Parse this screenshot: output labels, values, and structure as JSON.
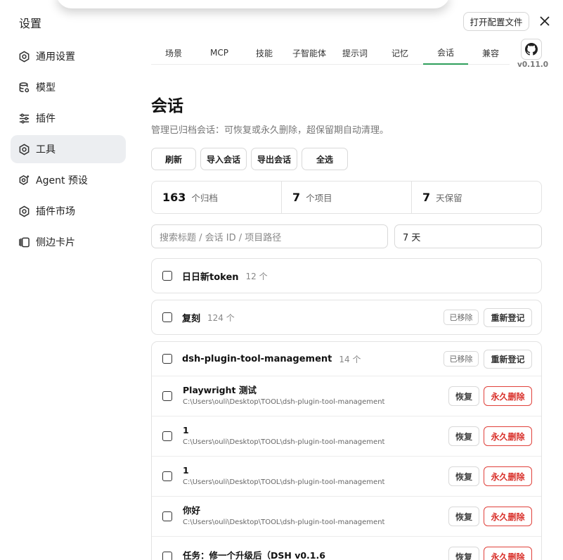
{
  "window": {
    "title": "设置",
    "open_config_label": "打开配置文件"
  },
  "sidebar": {
    "items": [
      {
        "label": "通用设置",
        "icon": "gear-icon"
      },
      {
        "label": "模型",
        "icon": "database-icon"
      },
      {
        "label": "插件",
        "icon": "sliders-icon"
      },
      {
        "label": "工具",
        "icon": "gear-icon",
        "active": true
      },
      {
        "label": "Agent 预设",
        "icon": "gear-sparkle-icon"
      },
      {
        "label": "插件市场",
        "icon": "gear-icon"
      },
      {
        "label": "侧边卡片",
        "icon": "side-card-icon"
      }
    ]
  },
  "tabs": {
    "items": [
      "场景",
      "MCP",
      "技能",
      "子智能体",
      "提示词",
      "记忆",
      "会话",
      "兼容"
    ],
    "active": "会话"
  },
  "version": "v0.11.0",
  "page": {
    "title": "会话",
    "description": "管理已归档会话：可恢复或永久删除，超保留期自动清理。"
  },
  "actions": {
    "refresh": "刷新",
    "import": "导入会话",
    "export": "导出会话",
    "select_all": "全选"
  },
  "stats": [
    {
      "value": "163",
      "unit": "个归档"
    },
    {
      "value": "7",
      "unit": "个项目"
    },
    {
      "value": "7",
      "unit": "天保留"
    }
  ],
  "search": {
    "placeholder": "搜索标题 / 会话 ID / 项目路径"
  },
  "retention_select": {
    "value": "7 天"
  },
  "labels": {
    "removed": "已移除",
    "reregister": "重新登记",
    "restore": "恢复",
    "delete": "永久删除"
  },
  "groups": [
    {
      "name": "日日新token",
      "count": "12 个"
    },
    {
      "name": "复刻",
      "count": "124 个"
    },
    {
      "name": "dsh-plugin-tool-management",
      "count": "14 个",
      "sessions": [
        {
          "title": "Playwright 测试",
          "path": "C:\\Users\\ouli\\Desktop\\TOOL\\dsh-plugin-tool-management"
        },
        {
          "title": "1",
          "path": "C:\\Users\\ouli\\Desktop\\TOOL\\dsh-plugin-tool-management"
        },
        {
          "title": "1",
          "path": "C:\\Users\\ouli\\Desktop\\TOOL\\dsh-plugin-tool-management"
        },
        {
          "title": "你好",
          "path": "C:\\Users\\ouli\\Desktop\\TOOL\\dsh-plugin-tool-management"
        },
        {
          "title": "任务：修一个升级后（DSH v0.1.6",
          "path": ""
        }
      ]
    }
  ],
  "colors": {
    "tab_active": "#2e9f5b",
    "danger": "#d9302a",
    "sidebar_active_bg": "#eceef1"
  }
}
